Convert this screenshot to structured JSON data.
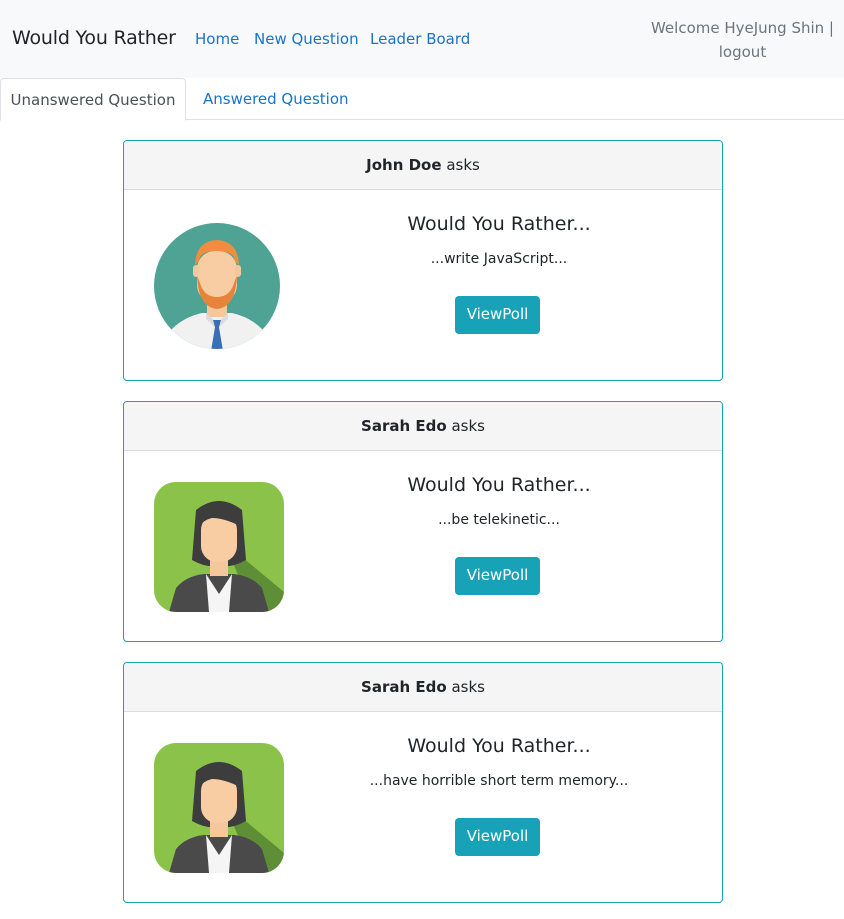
{
  "navbar": {
    "brand": "Would You Rather",
    "links": [
      "Home",
      "New Question",
      "Leader Board"
    ],
    "welcome": "Welcome HyeJung Shin |",
    "logout": "logout"
  },
  "tabs": {
    "unanswered": "Unanswered Question",
    "answered": "Answered Question"
  },
  "questions": [
    {
      "author": "John Doe",
      "asks": "asks",
      "title": "Would You Rather...",
      "preview": "...write JavaScript...",
      "button": "ViewPoll",
      "avatar": "man-avatar-icon"
    },
    {
      "author": "Sarah Edo",
      "asks": "asks",
      "title": "Would You Rather...",
      "preview": "...be telekinetic...",
      "button": "ViewPoll",
      "avatar": "woman-avatar-icon"
    },
    {
      "author": "Sarah Edo",
      "asks": "asks",
      "title": "Would You Rather...",
      "preview": "...have horrible short term memory...",
      "button": "ViewPoll",
      "avatar": "woman-avatar-icon"
    }
  ],
  "colors": {
    "accent": "#17a2b8",
    "link": "#1a73c9",
    "navbar_bg": "#f8f9fa"
  }
}
